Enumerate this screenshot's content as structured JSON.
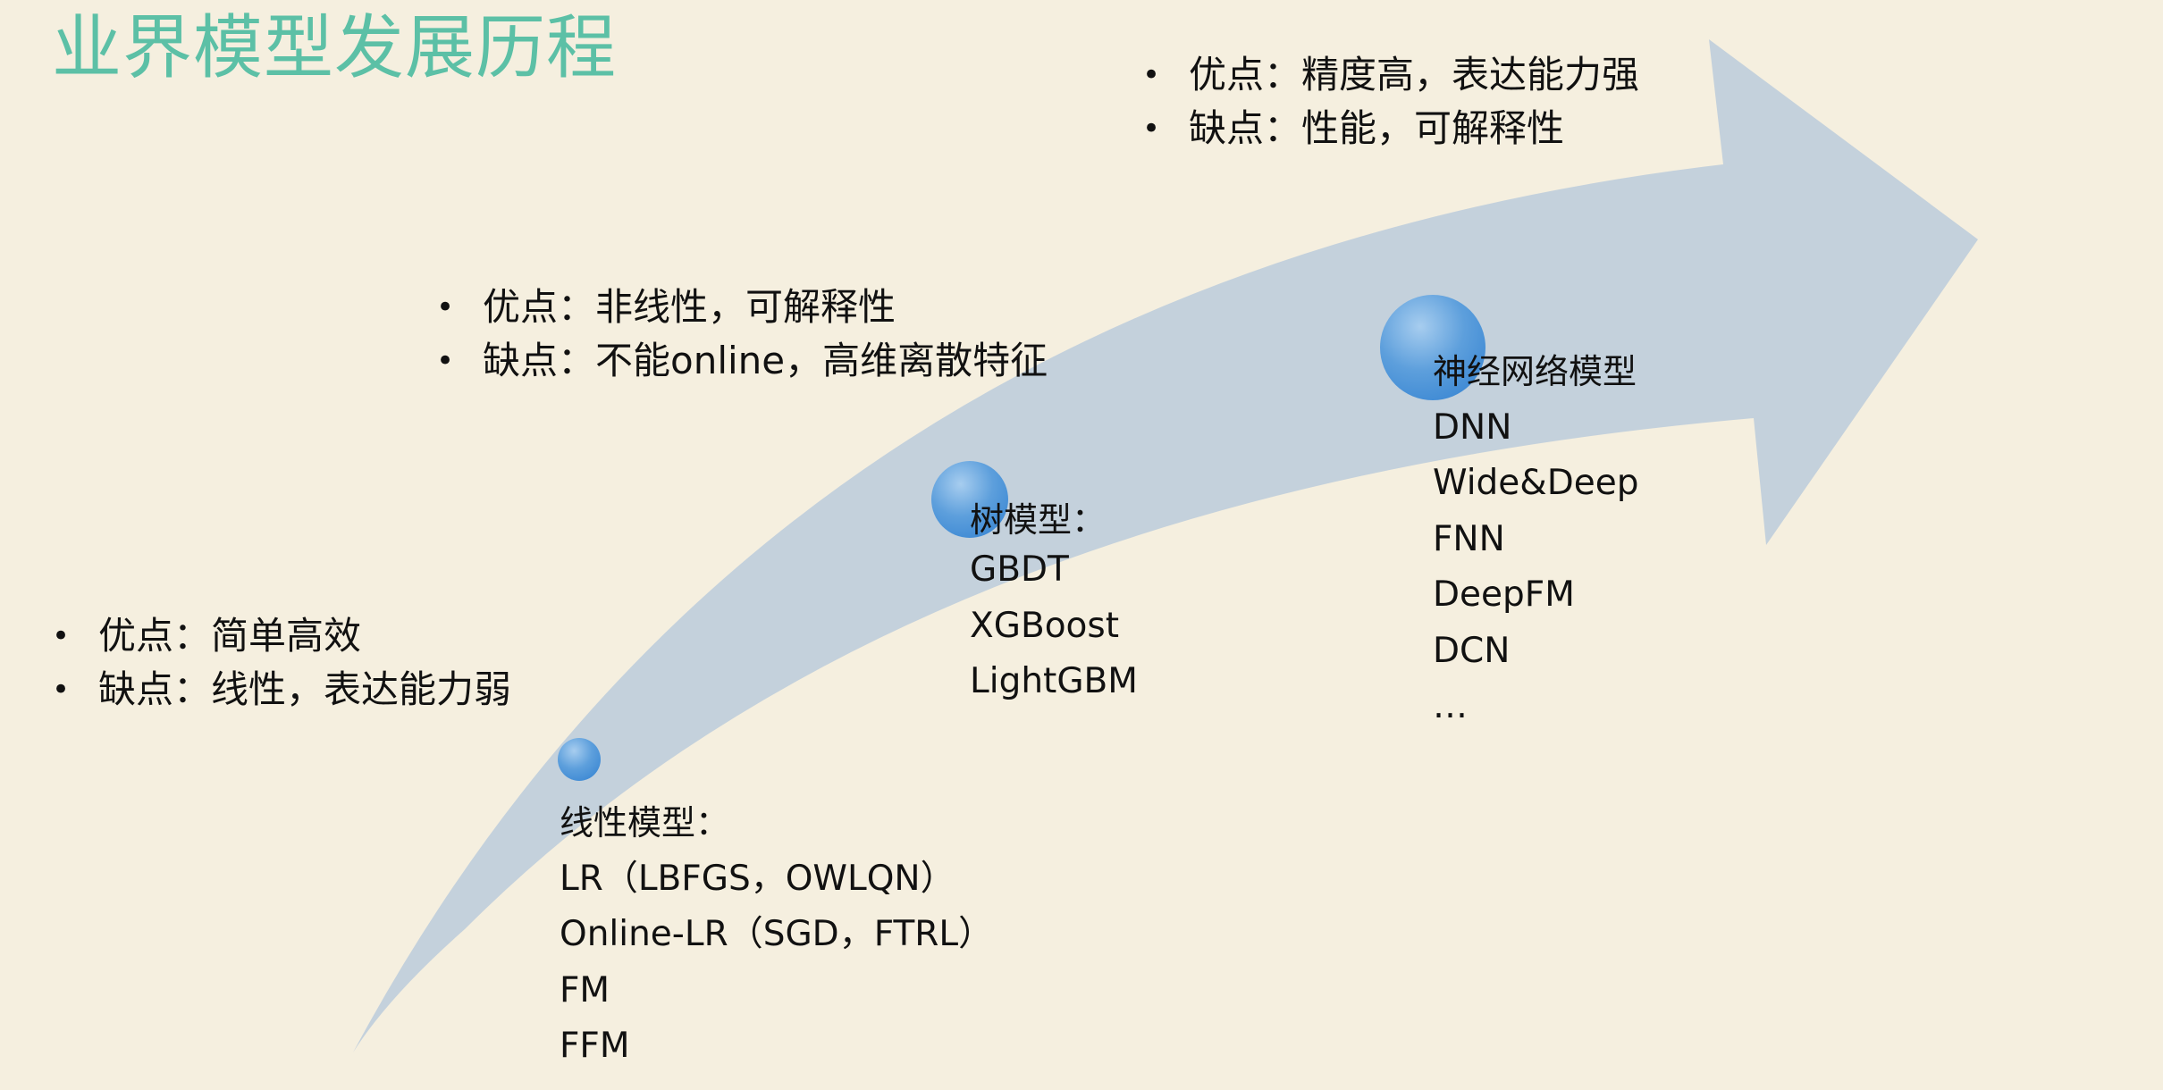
{
  "title": "业界模型发展历程",
  "colors": {
    "background": "#f5efdf",
    "title": "#5cc0a6",
    "arrow": "#c4d1dc",
    "node": "#3f8ad6"
  },
  "linear": {
    "pros": "优点：简单高效",
    "cons": "缺点：线性，表达能力弱",
    "heading": "线性模型：",
    "items": [
      "LR（LBFGS，OWLQN）",
      "Online-LR（SGD，FTRL）",
      "FM",
      "FFM"
    ]
  },
  "tree": {
    "pros": "优点：非线性，可解释性",
    "cons": "缺点：不能online，高维离散特征",
    "heading": "树模型：",
    "items": [
      "GBDT",
      "XGBoost",
      "LightGBM"
    ]
  },
  "neural": {
    "pros": "优点：精度高，表达能力强",
    "cons": "缺点：性能，可解释性",
    "heading": "神经网络模型",
    "items": [
      "DNN",
      "Wide&Deep",
      "FNN",
      "DeepFM",
      "DCN",
      "…"
    ]
  }
}
